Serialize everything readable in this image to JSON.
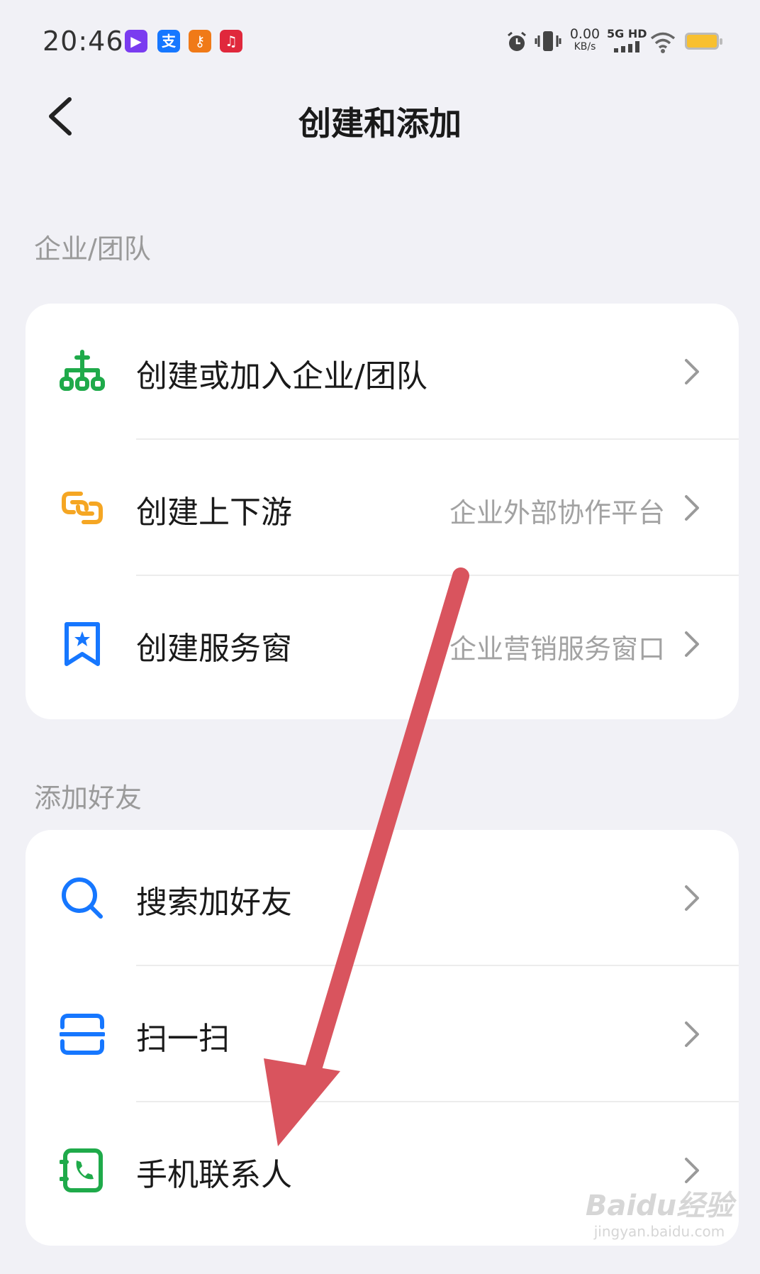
{
  "status_bar": {
    "time": "20:46",
    "net_speed_value": "0.00",
    "net_speed_unit": "KB/s",
    "network": "5G HD",
    "app_icons": [
      "video-app-icon",
      "alipay-icon",
      "key-app-icon",
      "music-app-icon"
    ]
  },
  "header": {
    "title": "创建和添加",
    "back_icon": "chevron-left-icon"
  },
  "sections": [
    {
      "label": "企业/团队",
      "items": [
        {
          "label": "创建或加入企业/团队",
          "sub": "",
          "icon": "org-tree-icon",
          "color": "#1faa4a"
        },
        {
          "label": "创建上下游",
          "sub": "企业外部协作平台",
          "icon": "link-icon",
          "color": "#f5a623"
        },
        {
          "label": "创建服务窗",
          "sub": "企业营销服务窗口",
          "icon": "bookmark-star-icon",
          "color": "#1677ff"
        }
      ]
    },
    {
      "label": "添加好友",
      "items": [
        {
          "label": "搜索加好友",
          "sub": "",
          "icon": "search-icon",
          "color": "#1677ff"
        },
        {
          "label": "扫一扫",
          "sub": "",
          "icon": "scan-icon",
          "color": "#1677ff"
        },
        {
          "label": "手机联系人",
          "sub": "",
          "icon": "phone-contact-icon",
          "color": "#1faa4a"
        }
      ]
    }
  ],
  "annotation": {
    "color": "#d9545e",
    "icon": "arrow-annotation"
  },
  "watermark": {
    "logo": "Baidu经验",
    "url": "jingyan.baidu.com"
  }
}
